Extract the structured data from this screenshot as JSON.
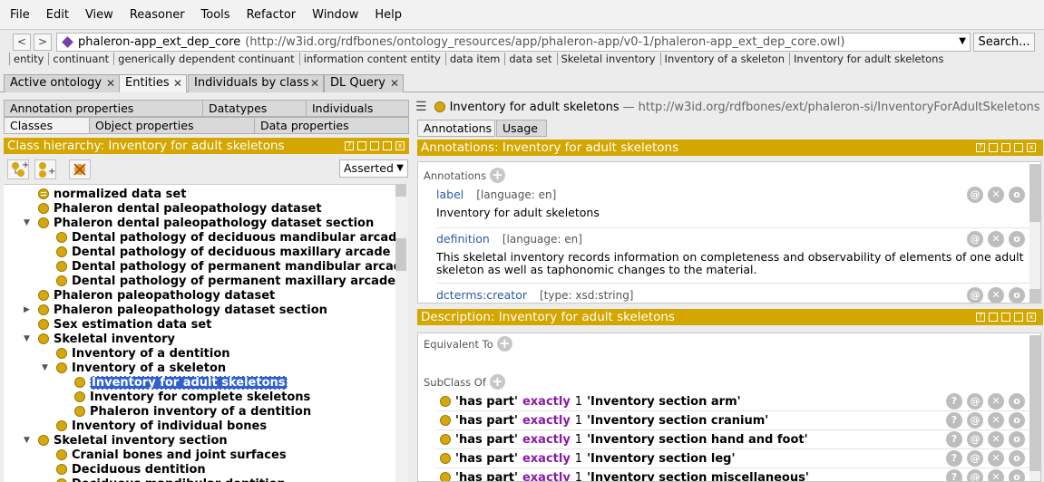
{
  "menu": [
    "File",
    "Edit",
    "View",
    "Reasoner",
    "Tools",
    "Refactor",
    "Window",
    "Help"
  ],
  "nav": {
    "back": "<",
    "forward": ">",
    "ontology_name": "phaleron-app_ext_dep_core",
    "ontology_iri": "(http://w3id.org/rdfbones/ontology_resources/app/phaleron-app/v0-1/phaleron-app_ext_dep_core.owl)",
    "search_label": "Search..."
  },
  "breadcrumb": [
    "entity",
    "continuant",
    "generically dependent continuant",
    "information content entity",
    "data item",
    "data set",
    "Skeletal inventory",
    "Inventory of a skeleton",
    "Inventory for adult skeletons"
  ],
  "tabs": [
    {
      "label": "Active ontology",
      "active": false
    },
    {
      "label": "Entities",
      "active": true
    },
    {
      "label": "Individuals by class",
      "active": false
    },
    {
      "label": "DL Query",
      "active": false
    }
  ],
  "left": {
    "subtabs_row1": [
      "Annotation properties",
      "Datatypes",
      "Individuals"
    ],
    "subtabs_row2": [
      "Classes",
      "Object properties",
      "Data properties"
    ],
    "hierarchy_title": "Class hierarchy: Inventory for adult skeletons",
    "asserted": "Asserted",
    "tree": [
      {
        "label": "normalized data set",
        "indent": 0,
        "toggle": "",
        "icon": "equiv"
      },
      {
        "label": "Phaleron dental paleopathology dataset",
        "indent": 0,
        "toggle": ""
      },
      {
        "label": "Phaleron dental paleopathology dataset section",
        "indent": 0,
        "toggle": "open"
      },
      {
        "label": "Dental pathology of deciduous mandibular arcade",
        "indent": 1,
        "toggle": ""
      },
      {
        "label": "Dental pathology of deciduous maxillary arcade",
        "indent": 1,
        "toggle": ""
      },
      {
        "label": "Dental pathology of permanent mandibular arcade",
        "indent": 1,
        "toggle": ""
      },
      {
        "label": "Dental pathology of permanent maxillary arcade",
        "indent": 1,
        "toggle": ""
      },
      {
        "label": "Phaleron paleopathology dataset",
        "indent": 0,
        "toggle": ""
      },
      {
        "label": "Phaleron paleopathology dataset section",
        "indent": 0,
        "toggle": "closed"
      },
      {
        "label": "Sex estimation data set",
        "indent": 0,
        "toggle": ""
      },
      {
        "label": "Skeletal inventory",
        "indent": 0,
        "toggle": "open"
      },
      {
        "label": "Inventory of a dentition",
        "indent": 1,
        "toggle": ""
      },
      {
        "label": "Inventory of a skeleton",
        "indent": 1,
        "toggle": "open"
      },
      {
        "label": "Inventory for adult skeletons",
        "indent": 2,
        "toggle": "",
        "selected": true
      },
      {
        "label": "Inventory for complete skeletons",
        "indent": 2,
        "toggle": ""
      },
      {
        "label": "Phaleron inventory of a dentition",
        "indent": 2,
        "toggle": ""
      },
      {
        "label": "Inventory of individual bones",
        "indent": 1,
        "toggle": ""
      },
      {
        "label": "Skeletal inventory section",
        "indent": 0,
        "toggle": "open"
      },
      {
        "label": "Cranial bones and joint surfaces",
        "indent": 1,
        "toggle": ""
      },
      {
        "label": "Deciduous dentition",
        "indent": 1,
        "toggle": ""
      },
      {
        "label": "Deciduous mandibular dentition",
        "indent": 1,
        "toggle": ""
      }
    ]
  },
  "right": {
    "entity_name": "Inventory for adult skeletons",
    "entity_iri": "http://w3id.org/rdfbones/ext/phaleron-si/InventoryForAdultSkeletons",
    "subtabs": [
      {
        "label": "Annotations",
        "active": true
      },
      {
        "label": "Usage",
        "active": false
      }
    ],
    "annotations_title": "Annotations: Inventory for adult skeletons",
    "annotations_label": "Annotations",
    "annotations": [
      {
        "prop": "label",
        "meta": "[language: en]",
        "value": "Inventory for adult skeletons"
      },
      {
        "prop": "definition",
        "meta": "[language: en]",
        "value": "This skeletal inventory records information on completeness and observability of elements of one adult skeleton as well as taphonomic changes to the material."
      },
      {
        "prop": "dcterms:creator",
        "meta": "[type: xsd:string]",
        "value": ""
      }
    ],
    "description_title": "Description: Inventory for adult skeletons",
    "equivalent_label": "Equivalent To",
    "subclass_label": "SubClass Of",
    "subclass": [
      {
        "prop": "'has part'",
        "kw": "exactly",
        "n": "1",
        "target": "'Inventory section arm'"
      },
      {
        "prop": "'has part'",
        "kw": "exactly",
        "n": "1",
        "target": "'Inventory section cranium'"
      },
      {
        "prop": "'has part'",
        "kw": "exactly",
        "n": "1",
        "target": "'Inventory section hand and foot'"
      },
      {
        "prop": "'has part'",
        "kw": "exactly",
        "n": "1",
        "target": "'Inventory section leg'"
      },
      {
        "prop": "'has part'",
        "kw": "exactly",
        "n": "1",
        "target": "'Inventory section miscellaneous'"
      }
    ]
  }
}
